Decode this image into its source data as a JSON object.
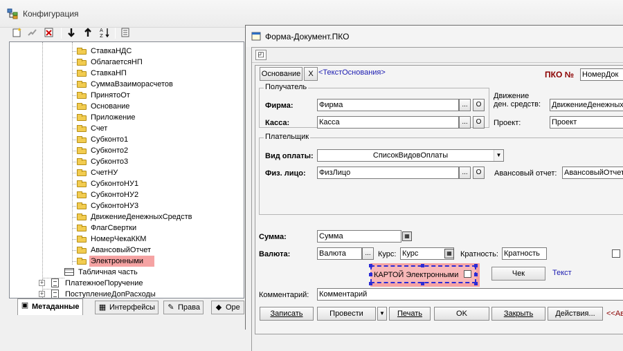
{
  "config_window": {
    "title": "Конфигурация",
    "toolbar": [
      "new-item-icon",
      "properties-icon",
      "delete-icon",
      "move-down-icon",
      "move-up-icon",
      "sort-icon",
      "description-icon"
    ],
    "tree": {
      "requisites": [
        "СтавкаНДС",
        "ОблагаетсяНП",
        "СтавкаНП",
        "СуммаВзаиморасчетов",
        "ПринятоОт",
        "Основание",
        "Приложение",
        "Счет",
        "Субконто1",
        "Субконто2",
        "Субконто3",
        "СчетНУ",
        "СубконтоНУ1",
        "СубконтоНУ2",
        "СубконтоНУ3",
        "ДвижениеДенежныхСредств",
        "ФлагСвертки",
        "НомерЧекаККМ",
        "АвансовыйОтчет",
        "Электронными"
      ],
      "selected": "Электронными",
      "table_part": "Табличная часть",
      "documents": [
        "ПлатежноеПоручение",
        "ПоступлениеДопРасходы"
      ]
    },
    "tabs": [
      "Метаданные",
      "Интерфейсы",
      "Права",
      "Оре"
    ]
  },
  "form_window": {
    "title": "Форма-Документ.ПКО",
    "osnovanie_button": "Основание",
    "x_button": "X",
    "osnovanie_text": "<ТекстОснования>",
    "pko_label": "ПКО №",
    "doc_number": "НомерДок",
    "recipient_group": "Получатель",
    "firma_label": "Фирма:",
    "firma_value": "Фирма",
    "kassa_label": "Касса:",
    "kassa_value": "Касса",
    "dds_label_1": "Движение",
    "dds_label_2": "ден. средств:",
    "dds_value": "ДвижениеДенежных",
    "project_label": "Проект:",
    "project_value": "Проект",
    "payer_group": "Плательщик",
    "payment_type_label": "Вид оплаты:",
    "payment_type_value": "СписокВидовОплаты",
    "person_label": "Физ. лицо:",
    "person_value": "ФизЛицо",
    "advance_label": "Авансовый отчет:",
    "advance_value": "АвансовыйОтчет",
    "sum_label": "Сумма:",
    "sum_value": "Сумма",
    "currency_label": "Валюта:",
    "currency_value": "Валюта",
    "rate_label": "Курс:",
    "rate_value": "Курс",
    "multiplicity_label": "Кратность:",
    "multiplicity_value": "Кратность",
    "card_checkbox_label": "КАРТОЙ Электронными",
    "check_button": "Чек",
    "text_label": "Текст",
    "comment_label": "Комментарий:",
    "comment_value": "Комментарий",
    "ellipsis": "...",
    "o_button": "О",
    "bottom_buttons": {
      "save": "Записать",
      "post": "Провести",
      "print": "Печать",
      "ok": "OK",
      "close": "Закрыть",
      "actions": "Действия...",
      "more": "<<Ав"
    }
  }
}
